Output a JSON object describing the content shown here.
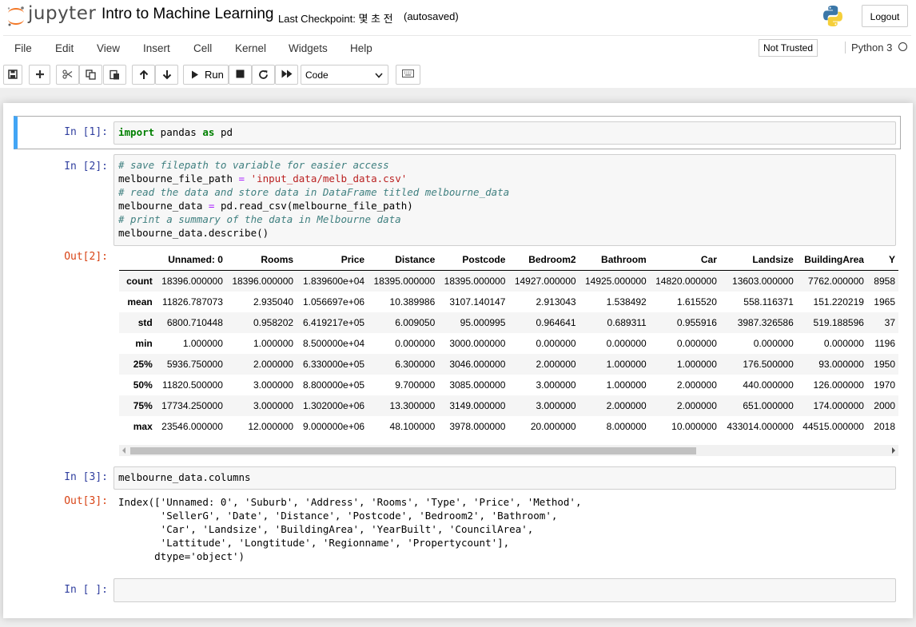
{
  "header": {
    "logo_text": "jupyter",
    "notebook_title": "Intro to Machine Learning",
    "checkpoint": "Last Checkpoint: 몇 초 전",
    "autosaved": "(autosaved)",
    "logout_label": "Logout"
  },
  "menubar": {
    "items": [
      "File",
      "Edit",
      "View",
      "Insert",
      "Cell",
      "Kernel",
      "Widgets",
      "Help"
    ],
    "trust_label": "Not Trusted",
    "kernel_label": "Python 3"
  },
  "toolbar": {
    "run_label": "Run",
    "cell_type": "Code"
  },
  "cells": {
    "c1": {
      "prompt": "In [1]:"
    },
    "c2": {
      "prompt": "In [2]:",
      "out_prompt": "Out[2]:"
    },
    "c3": {
      "prompt": "In [3]:",
      "out_prompt": "Out[3]:"
    },
    "c4": {
      "prompt": "In [ ]:"
    }
  },
  "code": {
    "c1_kw1": "import",
    "c1_mid": " pandas ",
    "c1_kw2": "as",
    "c1_end": " pd",
    "c2_l1": "# save filepath to variable for easier access",
    "c2_l2a": "melbourne_file_path ",
    "c2_l2op": "=",
    "c2_l2str": " 'input_data/melb_data.csv'",
    "c2_l3": "# read the data and store data in DataFrame titled melbourne_data",
    "c2_l4a": "melbourne_data ",
    "c2_l4op": "=",
    "c2_l4b": " pd.read_csv(melbourne_file_path)",
    "c2_l5": "# print a summary of the data in Melbourne data",
    "c2_l6": "melbourne_data.describe()",
    "c3": "melbourne_data.columns"
  },
  "describe_table": {
    "columns": [
      "Unnamed: 0",
      "Rooms",
      "Price",
      "Distance",
      "Postcode",
      "Bedroom2",
      "Bathroom",
      "Car",
      "Landsize",
      "BuildingArea",
      "Y"
    ],
    "rows": [
      {
        "label": "count",
        "values": [
          "18396.000000",
          "18396.000000",
          "1.839600e+04",
          "18395.000000",
          "18395.000000",
          "14927.000000",
          "14925.000000",
          "14820.000000",
          "13603.000000",
          "7762.000000",
          "8958"
        ]
      },
      {
        "label": "mean",
        "values": [
          "11826.787073",
          "2.935040",
          "1.056697e+06",
          "10.389986",
          "3107.140147",
          "2.913043",
          "1.538492",
          "1.615520",
          "558.116371",
          "151.220219",
          "1965"
        ]
      },
      {
        "label": "std",
        "values": [
          "6800.710448",
          "0.958202",
          "6.419217e+05",
          "6.009050",
          "95.000995",
          "0.964641",
          "0.689311",
          "0.955916",
          "3987.326586",
          "519.188596",
          "37"
        ]
      },
      {
        "label": "min",
        "values": [
          "1.000000",
          "1.000000",
          "8.500000e+04",
          "0.000000",
          "3000.000000",
          "0.000000",
          "0.000000",
          "0.000000",
          "0.000000",
          "0.000000",
          "1196"
        ]
      },
      {
        "label": "25%",
        "values": [
          "5936.750000",
          "2.000000",
          "6.330000e+05",
          "6.300000",
          "3046.000000",
          "2.000000",
          "1.000000",
          "1.000000",
          "176.500000",
          "93.000000",
          "1950"
        ]
      },
      {
        "label": "50%",
        "values": [
          "11820.500000",
          "3.000000",
          "8.800000e+05",
          "9.700000",
          "3085.000000",
          "3.000000",
          "1.000000",
          "2.000000",
          "440.000000",
          "126.000000",
          "1970"
        ]
      },
      {
        "label": "75%",
        "values": [
          "17734.250000",
          "3.000000",
          "1.302000e+06",
          "13.300000",
          "3149.000000",
          "3.000000",
          "2.000000",
          "2.000000",
          "651.000000",
          "174.000000",
          "2000"
        ]
      },
      {
        "label": "max",
        "values": [
          "23546.000000",
          "12.000000",
          "9.000000e+06",
          "48.100000",
          "3978.000000",
          "20.000000",
          "8.000000",
          "10.000000",
          "433014.000000",
          "44515.000000",
          "2018"
        ]
      }
    ]
  },
  "columns_output": {
    "l1": "Index(['Unnamed: 0', 'Suburb', 'Address', 'Rooms', 'Type', 'Price', 'Method',",
    "l2": "       'SellerG', 'Date', 'Distance', 'Postcode', 'Bedroom2', 'Bathroom',",
    "l3": "       'Car', 'Landsize', 'BuildingArea', 'YearBuilt', 'CouncilArea',",
    "l4": "       'Lattitude', 'Longtitude', 'Regionname', 'Propertycount'],",
    "l5": "      dtype='object')"
  },
  "colors": {
    "selected_border": "#42a5f5",
    "in_prompt": "#303f9f",
    "out_prompt": "#d84315",
    "jupyter_orange": "#f37726"
  }
}
